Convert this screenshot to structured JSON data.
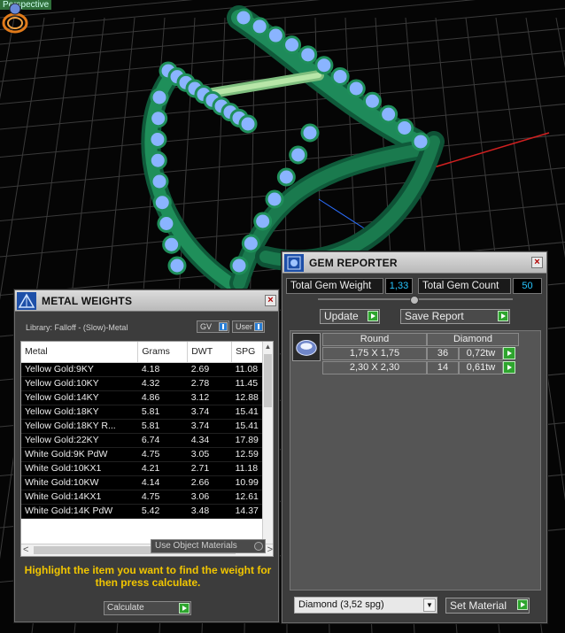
{
  "viewport": {
    "label": "Perspective",
    "accent_green": "#1f8f5a",
    "gem_blue": "#8ab4ff",
    "grid_color": "#3a3a3a"
  },
  "metal_weights": {
    "title": "METAL WEIGHTS",
    "library_label": "Library: Falloff - (Slow)-Metal",
    "gv_toggle": "GV",
    "user_toggle": "User",
    "columns": [
      "Metal",
      "Grams",
      "DWT",
      "SPG"
    ],
    "rows": [
      [
        "Yellow Gold:9KY",
        "4.18",
        "2.69",
        "11.08"
      ],
      [
        "Yellow Gold:10KY",
        "4.32",
        "2.78",
        "11.45"
      ],
      [
        "Yellow Gold:14KY",
        "4.86",
        "3.12",
        "12.88"
      ],
      [
        "Yellow Gold:18KY",
        "5.81",
        "3.74",
        "15.41"
      ],
      [
        "Yellow Gold:18KY R...",
        "5.81",
        "3.74",
        "15.41"
      ],
      [
        "Yellow Gold:22KY",
        "6.74",
        "4.34",
        "17.89"
      ],
      [
        "White Gold:9K PdW",
        "4.75",
        "3.05",
        "12.59"
      ],
      [
        "White Gold:10KX1",
        "4.21",
        "2.71",
        "11.18"
      ],
      [
        "White Gold:10KW",
        "4.14",
        "2.66",
        "10.99"
      ],
      [
        "White Gold:14KX1",
        "4.75",
        "3.06",
        "12.61"
      ],
      [
        "White Gold:14K PdW",
        "5.42",
        "3.48",
        "14.37"
      ]
    ],
    "use_object_materials": "Use Object Materials",
    "hint": "Highlight the item you want to find the weight for then press calculate.",
    "calculate_label": "Calculate"
  },
  "gem_reporter": {
    "title": "GEM REPORTER",
    "total_gem_weight_label": "Total Gem Weight",
    "total_gem_weight_value": "1,33",
    "total_gem_count_label": "Total Gem Count",
    "total_gem_count_value": "50",
    "update_label": "Update",
    "save_report_label": "Save Report",
    "shape_header": "Round",
    "material_header": "Diamond",
    "gems": [
      {
        "size": "1,75 X 1,75",
        "count": "36",
        "weight": "0,72tw"
      },
      {
        "size": "2,30 X 2,30",
        "count": "14",
        "weight": "0,61tw"
      }
    ],
    "material_select": "Diamond      (3,52 spg)",
    "set_material_label": "Set Material"
  }
}
